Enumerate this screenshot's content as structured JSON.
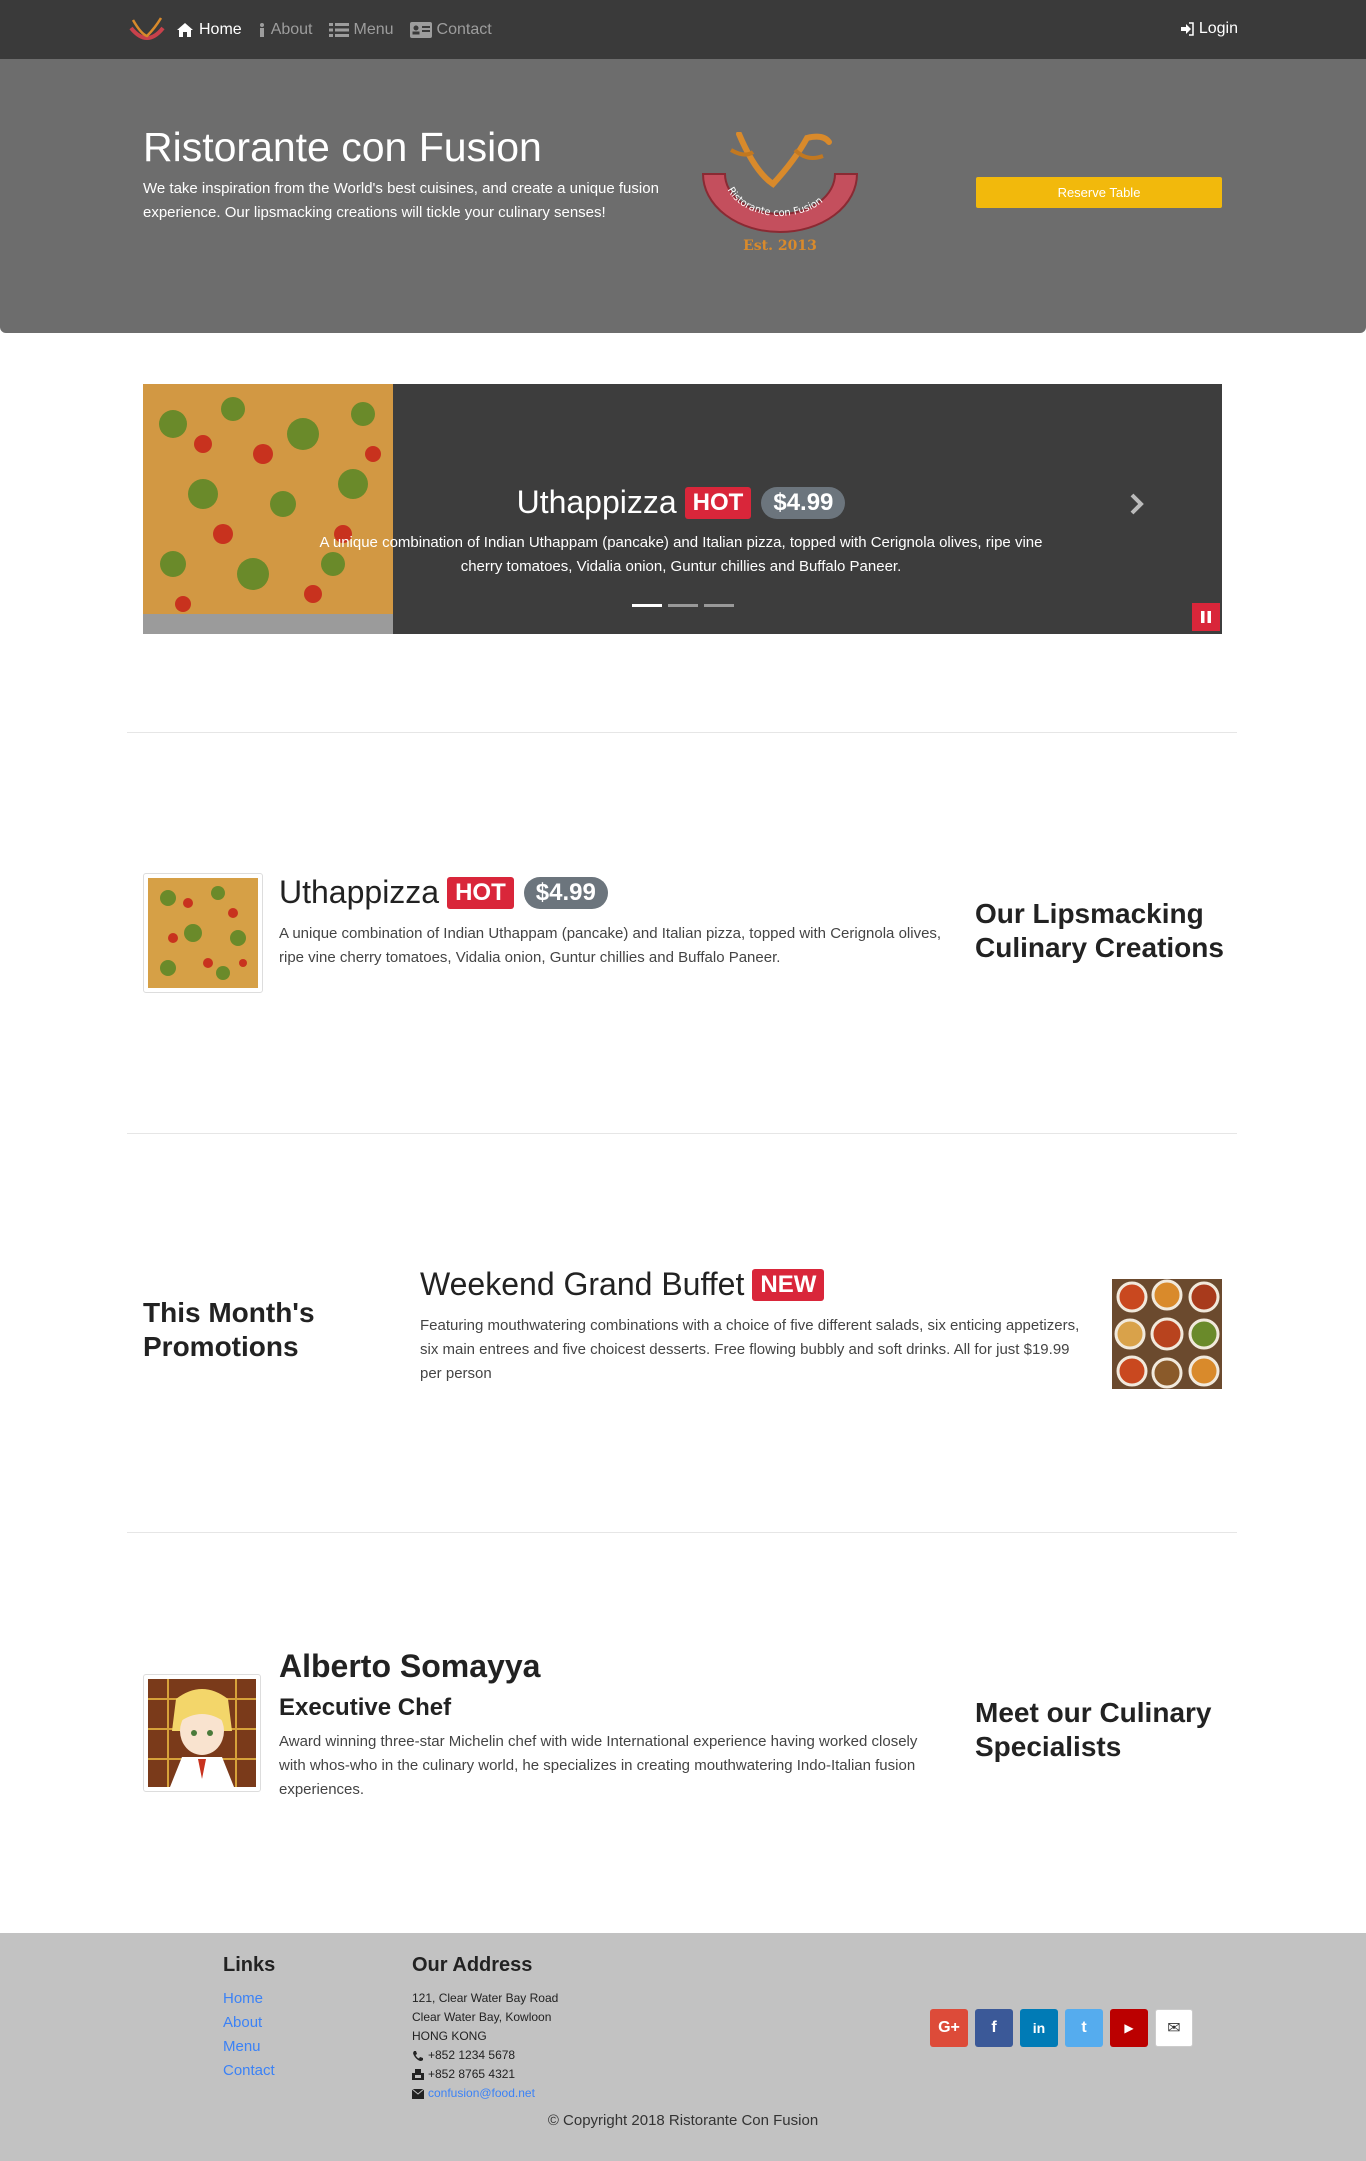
{
  "nav": {
    "items": [
      {
        "label": "Home",
        "icon": "home-icon"
      },
      {
        "label": "About",
        "icon": "info-icon"
      },
      {
        "label": "Menu",
        "icon": "list-icon"
      },
      {
        "label": "Contact",
        "icon": "address-card-icon"
      }
    ],
    "login_label": "Login"
  },
  "jumbotron": {
    "title": "Ristorante con Fusion",
    "text": "We take inspiration from the World's best cuisines, and create a unique fusion experience. Our lipsmacking creations will tickle your culinary senses!",
    "logo_text": "Ristorante con Fusion",
    "logo_est": "Est. 2013",
    "reserve_label": "Reserve Table"
  },
  "carousel": {
    "title": "Uthappizza",
    "badge": "HOT",
    "price": "$4.99",
    "text": "A unique combination of Indian Uthappam (pancake) and Italian pizza, topped with Cerignola olives, ripe vine cherry tomatoes, Vidalia onion, Guntur chillies and Buffalo Paneer.",
    "indicators": 3,
    "active_index": 0
  },
  "dish": {
    "title": "Uthappizza",
    "badge": "HOT",
    "price": "$4.99",
    "text": "A unique combination of Indian Uthappam (pancake) and Italian pizza, topped with Cerignola olives, ripe vine cherry tomatoes, Vidalia onion, Guntur chillies and Buffalo Paneer.",
    "side_heading": "Our Lipsmacking Culinary Creations"
  },
  "promotion": {
    "side_heading": "This Month's Promotions",
    "title": "Weekend Grand Buffet",
    "badge": "NEW",
    "text": "Featuring mouthwatering combinations with a choice of five different salads, six enticing appetizers, six main entrees and five choicest desserts. Free flowing bubbly and soft drinks. All for just $19.99 per person"
  },
  "leader": {
    "name": "Alberto Somayya",
    "role": "Executive Chef",
    "text": "Award winning three-star Michelin chef with wide International experience having worked closely with whos-who in the culinary world, he specializes in creating mouthwatering Indo-Italian fusion experiences.",
    "side_heading": "Meet our Culinary Specialists"
  },
  "footer": {
    "links_heading": "Links",
    "links": [
      "Home",
      "About",
      "Menu",
      "Contact"
    ],
    "address_heading": "Our Address",
    "address_lines": [
      "121, Clear Water Bay Road",
      "Clear Water Bay, Kowloon",
      "HONG KONG"
    ],
    "phone": "+852 1234 5678",
    "fax": "+852 8765 4321",
    "email": "confusion@food.net",
    "social": [
      {
        "name": "google-plus-icon",
        "glyph": "G+",
        "color": "#dd4b39"
      },
      {
        "name": "facebook-icon",
        "glyph": "f",
        "color": "#3b5998"
      },
      {
        "name": "linkedin-icon",
        "glyph": "in",
        "color": "#007bb6"
      },
      {
        "name": "twitter-icon",
        "glyph": "t",
        "color": "#55acee"
      },
      {
        "name": "youtube-icon",
        "glyph": "▶",
        "color": "#bb0000"
      },
      {
        "name": "mail-icon",
        "glyph": "✉",
        "color": "#ffffff"
      }
    ],
    "copyright": "© Copyright 2018 Ristorante Con Fusion"
  },
  "colors": {
    "navbar": "#3a3a3a",
    "jumbotron": "#6d6d6d",
    "accent": "#f2b90c",
    "hot_badge": "#d9263a",
    "footer": "#c2c2c2"
  }
}
